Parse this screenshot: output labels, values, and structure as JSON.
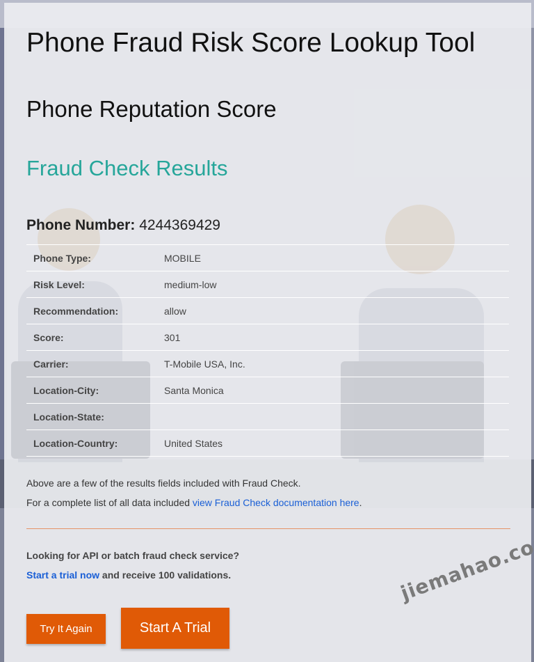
{
  "page": {
    "title": "Phone Fraud Risk Score Lookup Tool",
    "subtitle": "Phone Reputation Score",
    "results_heading": "Fraud Check Results"
  },
  "phone": {
    "label": "Phone Number:",
    "number": "4244369429"
  },
  "results": [
    {
      "key": "Phone Type:",
      "value": "MOBILE"
    },
    {
      "key": "Risk Level:",
      "value": "medium-low"
    },
    {
      "key": "Recommendation:",
      "value": "allow"
    },
    {
      "key": "Score:",
      "value": "301"
    },
    {
      "key": "Carrier:",
      "value": "T-Mobile USA, Inc."
    },
    {
      "key": "Location-City:",
      "value": "Santa Monica"
    },
    {
      "key": "Location-State:",
      "value": ""
    },
    {
      "key": "Location-Country:",
      "value": "United States"
    }
  ],
  "notes": {
    "line1": "Above are a few of the results fields included with Fraud Check.",
    "line2_prefix": "For a complete list of all data included ",
    "line2_link": "view Fraud Check documentation here",
    "line2_suffix": "."
  },
  "api": {
    "question": "Looking for API or batch fraud check service?",
    "trial_link": "Start a trial now",
    "trial_suffix": " and receive 100 validations."
  },
  "buttons": {
    "try_again": "Try It Again",
    "start_trial": "Start A Trial"
  },
  "watermark": "jiemahao.com",
  "colors": {
    "accent_teal": "#26a69a",
    "button_orange": "#e05a06",
    "link_blue": "#1a5fd6",
    "divider_orange": "#e69266"
  }
}
